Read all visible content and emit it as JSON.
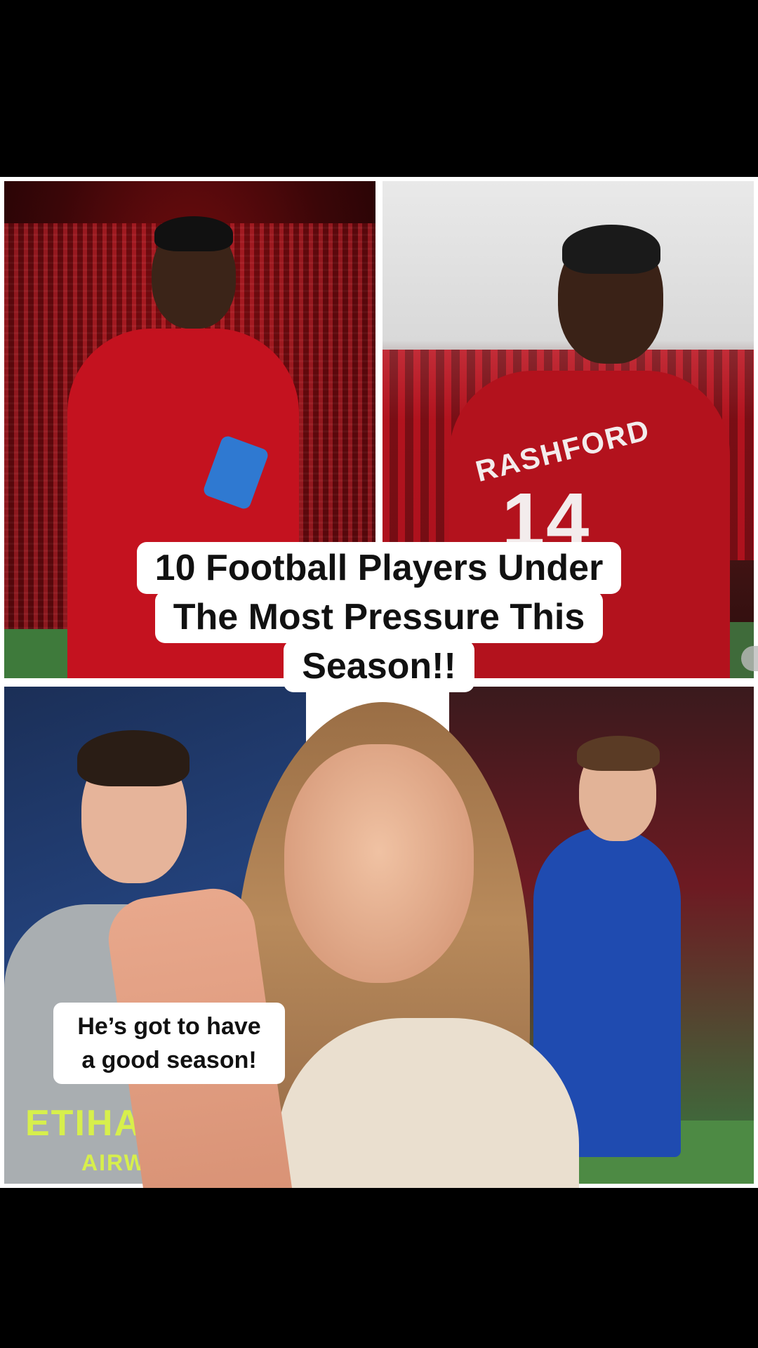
{
  "title_caption": {
    "line1": "10 Football Players Under",
    "line2": "The Most Pressure This",
    "line3": "Season!!"
  },
  "subtitle_caption": {
    "line1": "He’s got to have",
    "line2": "a good season!"
  },
  "jersey": {
    "top_right_name": "RASHFORD",
    "top_right_number": "14",
    "bottom_left_sponsor": "ETIHAD",
    "bottom_left_sponsor_sub": "AIRWAYS"
  },
  "colors": {
    "background": "#000000",
    "collage_border": "#ffffff",
    "caption_bg": "#ffffff",
    "caption_text": "#111111"
  }
}
